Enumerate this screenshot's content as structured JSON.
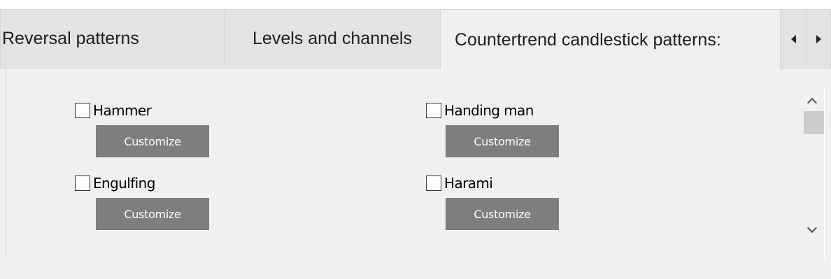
{
  "tabs": [
    {
      "label": "Reversal patterns",
      "selected": false
    },
    {
      "label": "Levels and channels",
      "selected": false
    },
    {
      "label": "Countertrend candlestick patterns:",
      "selected": true
    }
  ],
  "tab_scroll": {
    "left_icon": "triangle-left-icon",
    "right_icon": "triangle-right-icon"
  },
  "patterns": [
    {
      "label": "Hammer",
      "checked": false,
      "button": "Customize"
    },
    {
      "label": "Handing man",
      "checked": false,
      "button": "Customize"
    },
    {
      "label": "Engulfing",
      "checked": false,
      "button": "Customize"
    },
    {
      "label": "Harami",
      "checked": false,
      "button": "Customize"
    }
  ],
  "scrollbar": {
    "up_icon": "chevron-up-icon",
    "down_icon": "chevron-down-icon"
  },
  "colors": {
    "button_bg": "#7e7e7e",
    "button_text": "#ffffff",
    "tab_bg": "#e3e3e3",
    "panel_bg": "#f0f0f0"
  }
}
